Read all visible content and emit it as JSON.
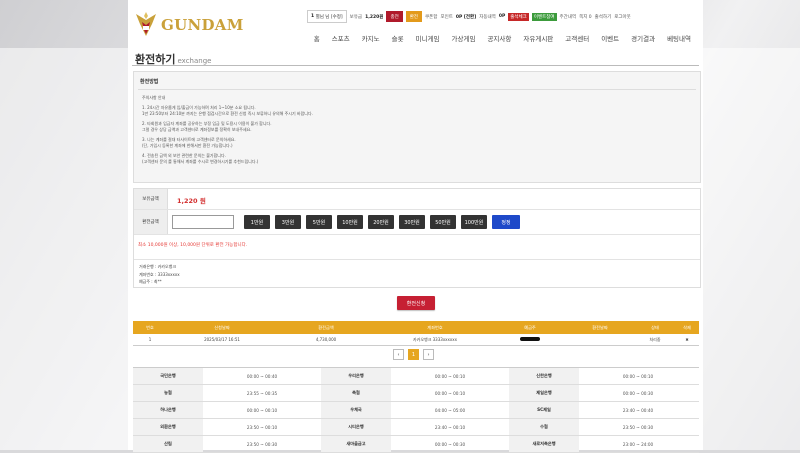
{
  "brand": {
    "name": "GUNDAM"
  },
  "topbar": {
    "level": "1",
    "user": "별님 님 [수정]",
    "balance_label": "보유금",
    "balance": "1,220원",
    "charge": "충전",
    "exchange": "환전",
    "coupon": "쿠폰함",
    "point_label": "포인트",
    "point": "0P [전환]",
    "fav_label": "자동내역",
    "fav_count": "0P",
    "badge_red": "출석체크",
    "badge_green": "이벤트참여",
    "notice": "주간내역",
    "message": "쪽지 0",
    "customer": "출석하기",
    "logout": "로그아웃"
  },
  "nav": [
    "홈",
    "스포츠",
    "카지노",
    "슬롯",
    "미니게임",
    "가상게임",
    "공지사항",
    "자유게시판",
    "고객센터",
    "이벤트",
    "경기결과",
    "베팅내역"
  ],
  "page": {
    "title": "환전하기",
    "subtitle": "exchange"
  },
  "notice": {
    "head": "환전방법",
    "lines": [
      "주의사항 안내",
      "",
      "1. 24시간 자유롭게 입/출금이 가능하며 처리 1~10분 소요 됩니다.",
      "1만 23:50부터 24:10분 까지는 은행 점검시간으로 환전 신청 즉시 보류하니 유의해 주시기 바랍니다.",
      "",
      "2. 타회원과 입금자 계좌를 공유하는 부정 입금 및 도용시 이용이 불가 합니다.",
      "그럴 경우 상당 금액과 고객센터로 계좌정보를 정확히 보내주세요.",
      "",
      "3. 나는 계좌를 절대 타사이트에 고객센터로 문의하세요.",
      "(단, 가입시 등록한 계좌에 한해서만 환전 가능합니다.)",
      "",
      "4. 전송된 금액 외 보안 관련한 문의는 불가합니다.",
      "(고객센터 문의 를 통해서 계좌를 수시로 변경하시기를 추천드립니다.)"
    ]
  },
  "form": {
    "balance_label": "보유금액",
    "balance_value": "1,220 원",
    "amount_label": "환전금액",
    "amount_value": "",
    "buttons": [
      "1만원",
      "3만원",
      "5만원",
      "10만원",
      "20만원",
      "30만원",
      "50만원",
      "100만원"
    ],
    "reset": "정정",
    "warning": "최소 10,000원 이상, 10,000원 단위로 환전 가능합니다.",
    "bank_name": "거래은행 : 카카오뱅크",
    "account": "계좌번호 : 3333xxxxx",
    "holder": "예금주 : 최**"
  },
  "submit": "환전신청",
  "history": {
    "columns": [
      "번호",
      "신청날짜",
      "환전금액",
      "계좌번호",
      "예금주",
      "환전날짜",
      "상태",
      "삭제"
    ],
    "rows": [
      {
        "no": "1",
        "date": "2025/03/17 16:51",
        "amount": "4,730,000",
        "account": "카카오뱅크 3333xxxxxx",
        "holder": "",
        "paid": "",
        "status": "처리중",
        "delete": "✖"
      }
    ]
  },
  "pager": {
    "prev": "‹",
    "current": "1",
    "next": "›"
  },
  "banks": [
    [
      "국민은행",
      "00:00 ~ 00:40",
      "우리은행",
      "00:00 ~ 00:10",
      "신한은행",
      "00:00 ~ 00:10"
    ],
    [
      "농협",
      "23:55 ~ 00:35",
      "축협",
      "00:00 ~ 00:10",
      "제일은행",
      "00:00 ~ 00:30"
    ],
    [
      "하나은행",
      "00:00 ~ 00:10",
      "우체국",
      "04:00 ~ 05:00",
      "SC제일",
      "23:40 ~ 00:40"
    ],
    [
      "외환은행",
      "23:50 ~ 00:10",
      "시티은행",
      "23:40 ~ 00:10",
      "수협",
      "23:50 ~ 00:30"
    ],
    [
      "산림",
      "23:50 ~ 00:30",
      "새마을금고",
      "00:00 ~ 00:30",
      "새로저축은행",
      "23:00 ~ 24:00"
    ]
  ],
  "colors": {
    "accent": "#e6a620",
    "red": "#c62033",
    "blue": "#1e49c9"
  }
}
